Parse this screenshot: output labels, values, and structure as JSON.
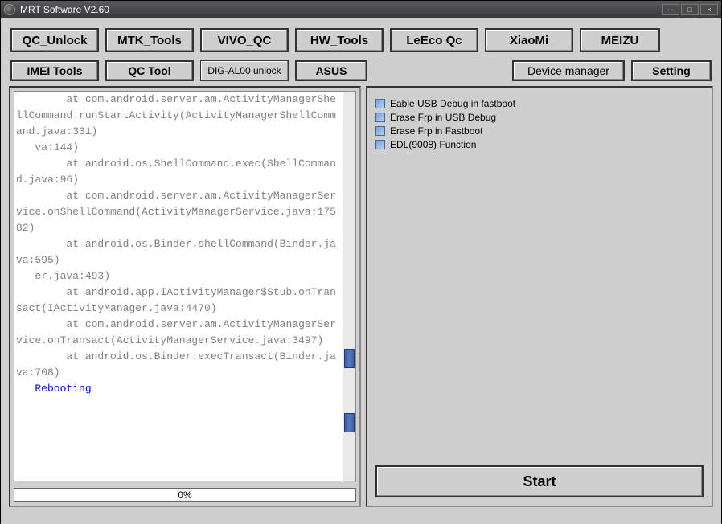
{
  "window": {
    "title": "MRT Software V2.60"
  },
  "win_controls": {
    "min": "─",
    "max": "□",
    "close": "×"
  },
  "toolbar": {
    "row1": [
      "QC_Unlock",
      "MTK_Tools",
      "VIVO_QC",
      "HW_Tools",
      "LeEco Qc",
      "XiaoMi",
      "MEIZU"
    ],
    "row2_left": [
      "IMEI Tools",
      "QC Tool",
      "DIG-AL00 unlock",
      "ASUS"
    ],
    "row2_right": [
      "Device manager",
      "Setting"
    ]
  },
  "log": {
    "lines": [
      "        at com.android.server.am.ActivityManagerShellCommand.runStartActivity(ActivityManagerShellCommand.java:331)",
      "   va:144)",
      "        at android.os.ShellCommand.exec(ShellCommand.java:96)",
      "        at com.android.server.am.ActivityManagerService.onShellCommand(ActivityManagerService.java:17582)",
      "        at android.os.Binder.shellCommand(Binder.java:595)",
      "   er.java:493)",
      "        at android.app.IActivityManager$Stub.onTransact(IActivityManager.java:4470)",
      "        at com.android.server.am.ActivityManagerService.onTransact(ActivityManagerService.java:3497)",
      "        at android.os.Binder.execTransact(Binder.java:708)"
    ],
    "final_line": "   Rebooting"
  },
  "progress": {
    "label": "0%"
  },
  "options": [
    "Eable USB Debug in fastboot",
    "Erase Frp in USB Debug",
    "Erase Frp in Fastboot",
    "EDL(9008) Function"
  ],
  "start": {
    "label": "Start"
  }
}
